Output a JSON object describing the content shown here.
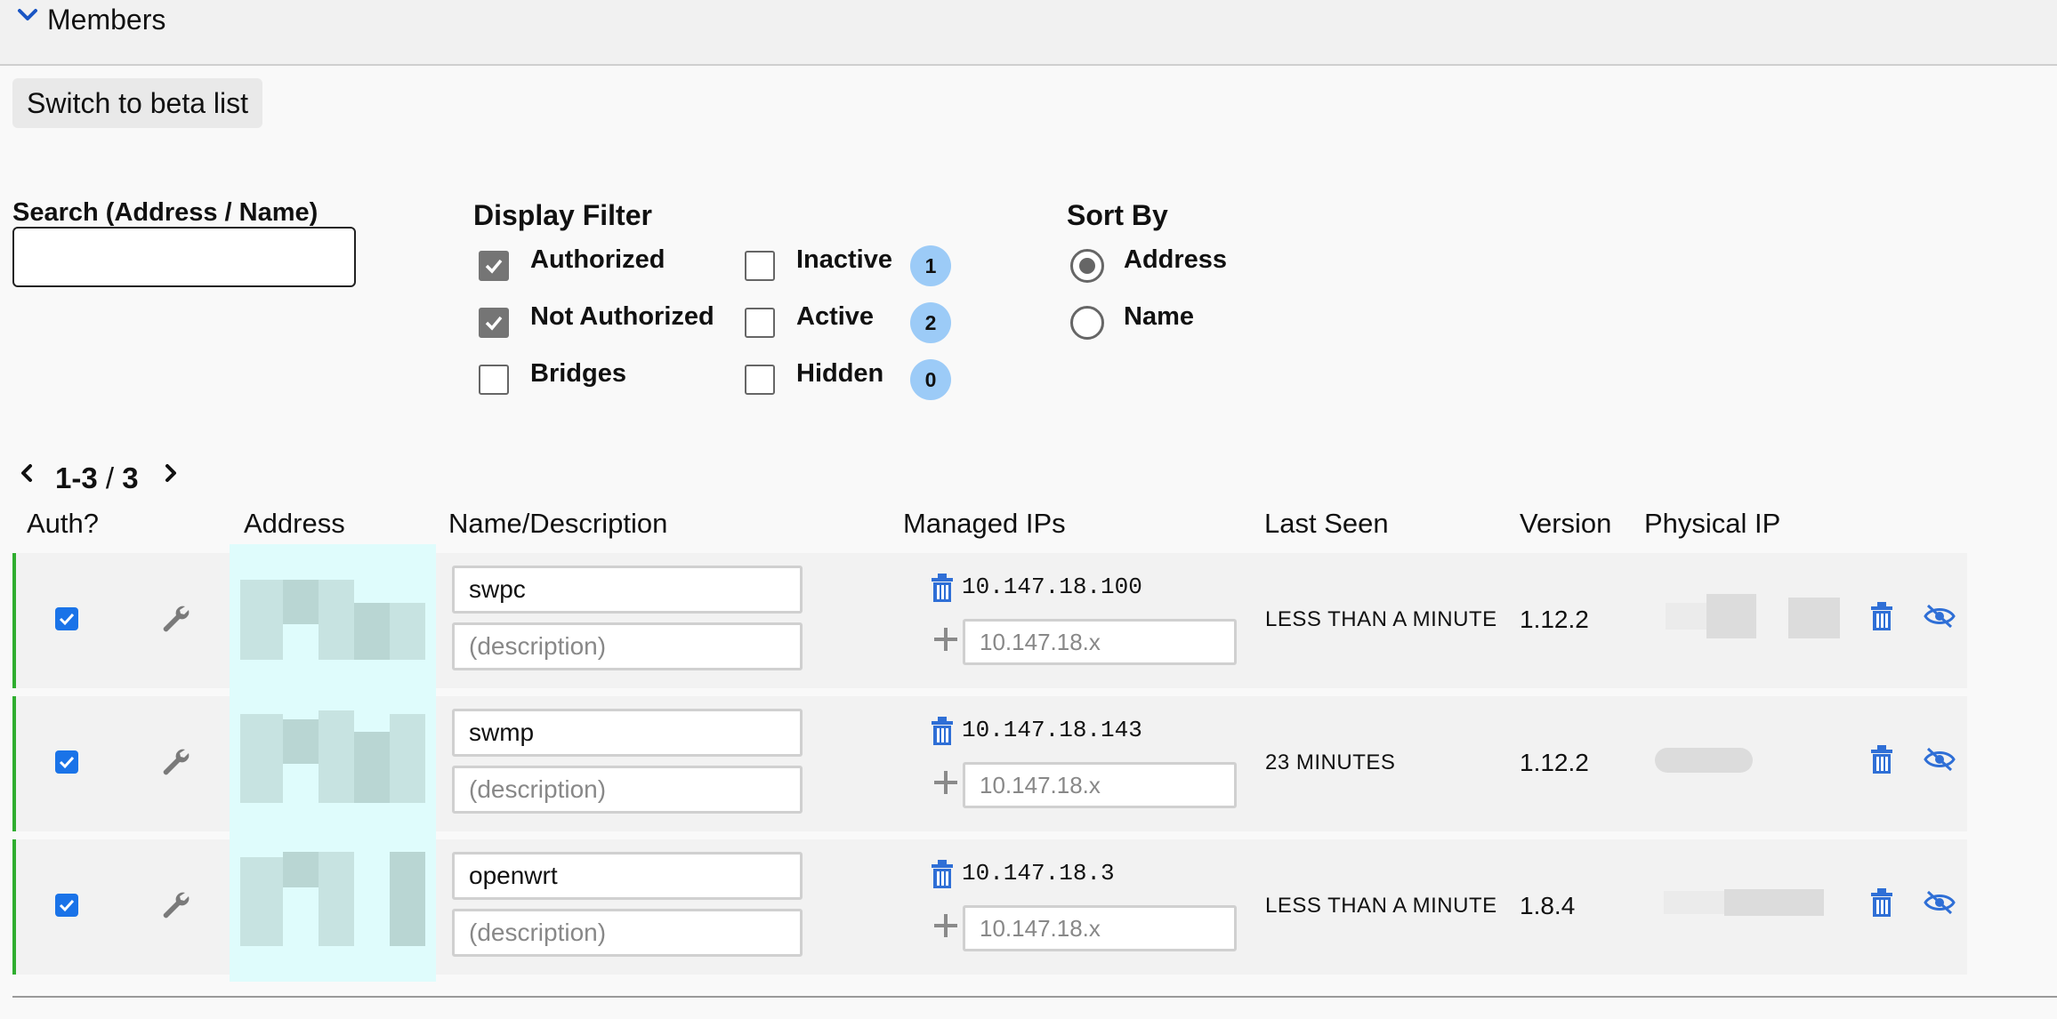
{
  "section": {
    "title": "Members"
  },
  "beta_button": {
    "label": "Switch to beta list"
  },
  "search": {
    "label": "Search (Address / Name)",
    "value": "",
    "placeholder": ""
  },
  "display_filter": {
    "title": "Display Filter",
    "options": [
      {
        "label": "Authorized",
        "checked": true
      },
      {
        "label": "Not Authorized",
        "checked": true
      },
      {
        "label": "Bridges",
        "checked": false
      }
    ],
    "status_options": [
      {
        "label": "Inactive",
        "checked": false,
        "count": "1"
      },
      {
        "label": "Active",
        "checked": false,
        "count": "2"
      },
      {
        "label": "Hidden",
        "checked": false,
        "count": "0"
      }
    ]
  },
  "sort_by": {
    "title": "Sort By",
    "options": [
      {
        "label": "Address",
        "selected": true
      },
      {
        "label": "Name",
        "selected": false
      }
    ]
  },
  "pagination": {
    "range": "1-3",
    "separator": " / ",
    "total": "3"
  },
  "columns": {
    "auth": "Auth?",
    "address": "Address",
    "name": "Name/Description",
    "managed_ips": "Managed IPs",
    "last_seen": "Last Seen",
    "version": "Version",
    "physical_ip": "Physical IP"
  },
  "members": [
    {
      "authorized": true,
      "name": "swpc",
      "description_placeholder": "(description)",
      "ip": "10.147.18.100",
      "ip_placeholder": "10.147.18.x",
      "last_seen": "LESS THAN A MINUTE",
      "version": "1.12.2"
    },
    {
      "authorized": true,
      "name": "swmp",
      "description_placeholder": "(description)",
      "ip": "10.147.18.143",
      "ip_placeholder": "10.147.18.x",
      "last_seen": "23 MINUTES",
      "version": "1.12.2"
    },
    {
      "authorized": true,
      "name": "openwrt",
      "description_placeholder": "(description)",
      "ip": "10.147.18.3",
      "ip_placeholder": "10.147.18.x",
      "last_seen": "LESS THAN A MINUTE",
      "version": "1.8.4"
    }
  ],
  "icons": {
    "collapse": "chevron-down-icon",
    "prev": "chevron-left-icon",
    "next": "chevron-right-icon",
    "settings": "wrench-icon",
    "delete": "trash-icon",
    "add": "plus-icon",
    "hide": "eye-slash-icon"
  },
  "colors": {
    "accent": "#1a73e8",
    "icon_blue": "#2f6fd6",
    "badge": "#9ccbf7",
    "authorized_bar": "#2fae2f"
  }
}
